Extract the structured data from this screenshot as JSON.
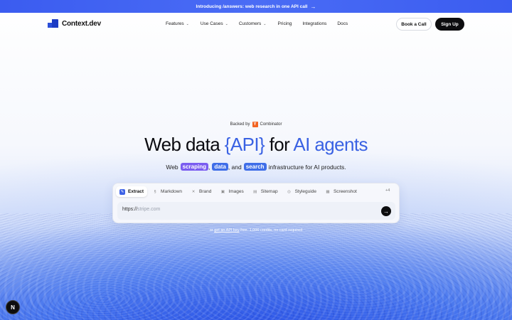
{
  "announcement": {
    "text": "Introducing /answers: web research in one API call",
    "arrow": "→"
  },
  "brand": {
    "name": "Context.dev"
  },
  "nav": {
    "items": [
      {
        "label": "Features",
        "chevron": "⌄"
      },
      {
        "label": "Use Cases",
        "chevron": "⌄"
      },
      {
        "label": "Customers",
        "chevron": "⌄"
      },
      {
        "label": "Pricing"
      },
      {
        "label": "Integrations"
      },
      {
        "label": "Docs"
      }
    ],
    "book_call": "Book a Call",
    "sign_up": "Sign Up"
  },
  "hero": {
    "backed_prefix": "Backed by",
    "yc_letter": "Y",
    "backed_suffix": "Combinator",
    "headline_1": "Web data ",
    "headline_2": "{API}",
    "headline_3": " for ",
    "headline_4": "AI agents",
    "sub_1": "Web",
    "chip_1": "scraping",
    "sub_2": ",",
    "chip_2": "data",
    "sub_3": ", and",
    "chip_3": "search",
    "sub_4": "infrastructure for AI products."
  },
  "tool": {
    "tabs": [
      {
        "label": "Extract",
        "icon": "wand-icon",
        "glyph": "✎"
      },
      {
        "label": "Markdown",
        "icon": "markdown-icon",
        "glyph": "§"
      },
      {
        "label": "Brand",
        "icon": "brand-icon",
        "glyph": "✕"
      },
      {
        "label": "Images",
        "icon": "image-icon",
        "glyph": "▣"
      },
      {
        "label": "Sitemap",
        "icon": "sitemap-icon",
        "glyph": "▤"
      },
      {
        "label": "Styleguide",
        "icon": "palette-icon",
        "glyph": "◎"
      },
      {
        "label": "Screenshot",
        "icon": "screenshot-icon",
        "glyph": "▦"
      }
    ],
    "more": "+4",
    "url_prefix": "https://",
    "url_placeholder": "stripe.com",
    "go_icon": "→"
  },
  "api_note": {
    "prefix": "or ",
    "link": "get an API key",
    "suffix": " free. 1,000 credits, no card required"
  },
  "badge": {
    "label": "N"
  },
  "colors": {
    "accent": "#3a62e3",
    "chip_purple": "#7a5cf0",
    "chip_blue": "#3f6ee8",
    "announce_bg": "#4a6cf5"
  }
}
